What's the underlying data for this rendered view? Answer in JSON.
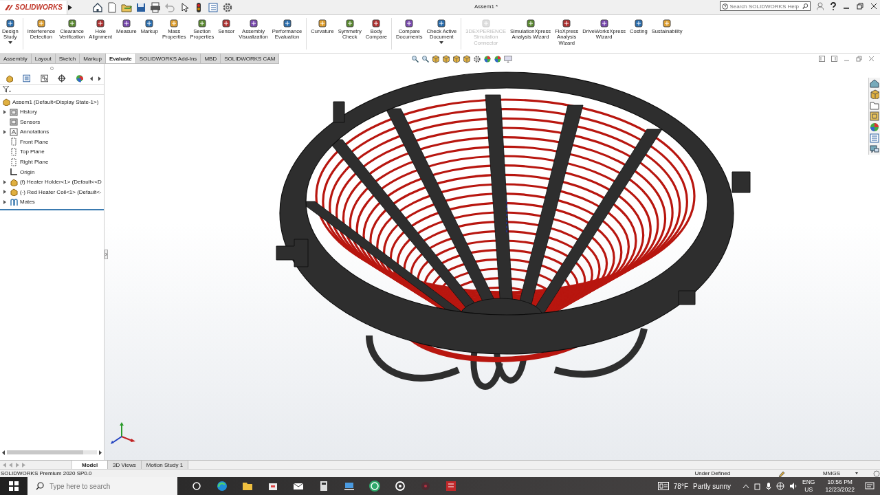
{
  "window": {
    "app_name": "SOLIDWORKS",
    "title": "Assem1 *"
  },
  "help_search": {
    "placeholder": "Search SOLIDWORKS Help"
  },
  "ribbon": [
    {
      "label": "Design\nStudy",
      "disabled": false,
      "dropdown": true,
      "separator_before": false
    },
    {
      "label": "Interference\nDetection",
      "disabled": false,
      "dropdown": false,
      "separator_before": true
    },
    {
      "label": "Clearance\nVerification",
      "disabled": false,
      "dropdown": false,
      "separator_before": false
    },
    {
      "label": "Hole\nAlignment",
      "disabled": false,
      "dropdown": false,
      "separator_before": false
    },
    {
      "label": "Measure",
      "disabled": false,
      "dropdown": false,
      "separator_before": false
    },
    {
      "label": "Markup",
      "disabled": false,
      "dropdown": false,
      "separator_before": false
    },
    {
      "label": "Mass\nProperties",
      "disabled": false,
      "dropdown": false,
      "separator_before": false
    },
    {
      "label": "Section\nProperties",
      "disabled": false,
      "dropdown": false,
      "separator_before": false
    },
    {
      "label": "Sensor",
      "disabled": false,
      "dropdown": false,
      "separator_before": false
    },
    {
      "label": "Assembly\nVisualization",
      "disabled": false,
      "dropdown": false,
      "separator_before": false
    },
    {
      "label": "Performance\nEvaluation",
      "disabled": false,
      "dropdown": false,
      "separator_before": false
    },
    {
      "label": "Curvature",
      "disabled": false,
      "dropdown": false,
      "separator_before": true
    },
    {
      "label": "Symmetry\nCheck",
      "disabled": false,
      "dropdown": false,
      "separator_before": false
    },
    {
      "label": "Body\nCompare",
      "disabled": false,
      "dropdown": false,
      "separator_before": false
    },
    {
      "label": "Compare\nDocuments",
      "disabled": false,
      "dropdown": false,
      "separator_before": true
    },
    {
      "label": "Check Active\nDocument",
      "disabled": false,
      "dropdown": true,
      "separator_before": false
    },
    {
      "label": "3DEXPERIENCE\nSimulation\nConnector",
      "disabled": true,
      "dropdown": false,
      "separator_before": true
    },
    {
      "label": "SimulationXpress\nAnalysis Wizard",
      "disabled": false,
      "dropdown": false,
      "separator_before": false
    },
    {
      "label": "FloXpress\nAnalysis\nWizard",
      "disabled": false,
      "dropdown": false,
      "separator_before": false
    },
    {
      "label": "DriveWorksXpress\nWizard",
      "disabled": false,
      "dropdown": false,
      "separator_before": false
    },
    {
      "label": "Costing",
      "disabled": false,
      "dropdown": false,
      "separator_before": false
    },
    {
      "label": "Sustainability",
      "disabled": false,
      "dropdown": false,
      "separator_before": false
    }
  ],
  "tabs": [
    {
      "label": "Assembly",
      "selected": false
    },
    {
      "label": "Layout",
      "selected": false
    },
    {
      "label": "Sketch",
      "selected": false
    },
    {
      "label": "Markup",
      "selected": false
    },
    {
      "label": "Evaluate",
      "selected": true
    },
    {
      "label": "SOLIDWORKS Add-Ins",
      "selected": false
    },
    {
      "label": "MBD",
      "selected": false
    },
    {
      "label": "SOLIDWORKS CAM",
      "selected": false
    }
  ],
  "feature_tree": {
    "root": "Assem1  (Default<Display State-1>)",
    "items": [
      {
        "label": "History",
        "kind": "folder",
        "expandable": true
      },
      {
        "label": "Sensors",
        "kind": "folder",
        "expandable": false
      },
      {
        "label": "Annotations",
        "kind": "annotation",
        "expandable": true
      },
      {
        "label": "Front Plane",
        "kind": "plane",
        "expandable": false
      },
      {
        "label": "Top Plane",
        "kind": "plane",
        "expandable": false
      },
      {
        "label": "Right Plane",
        "kind": "plane",
        "expandable": false
      },
      {
        "label": "Origin",
        "kind": "origin",
        "expandable": false
      },
      {
        "label": "(f) Heater Holder<1> (Default<<D",
        "kind": "part",
        "expandable": true
      },
      {
        "label": "(-) Red Heater Coil<1> (Default<-",
        "kind": "part",
        "expandable": true
      },
      {
        "label": "Mates",
        "kind": "mates",
        "expandable": true
      }
    ]
  },
  "bottom_tabs": [
    {
      "label": "Model",
      "selected": true
    },
    {
      "label": "3D Views",
      "selected": false
    },
    {
      "label": "Motion Study 1",
      "selected": false
    }
  ],
  "status_bar": {
    "product": "SOLIDWORKS Premium 2020 SP0.0",
    "state": "Under Defined",
    "units": "MMGS"
  },
  "taskbar": {
    "search_placeholder": "Type here to search",
    "temperature": "78°F",
    "weather": "Partly sunny",
    "language": "ENG",
    "region": "US",
    "time": "10:56 PM",
    "date": "12/23/2022"
  }
}
